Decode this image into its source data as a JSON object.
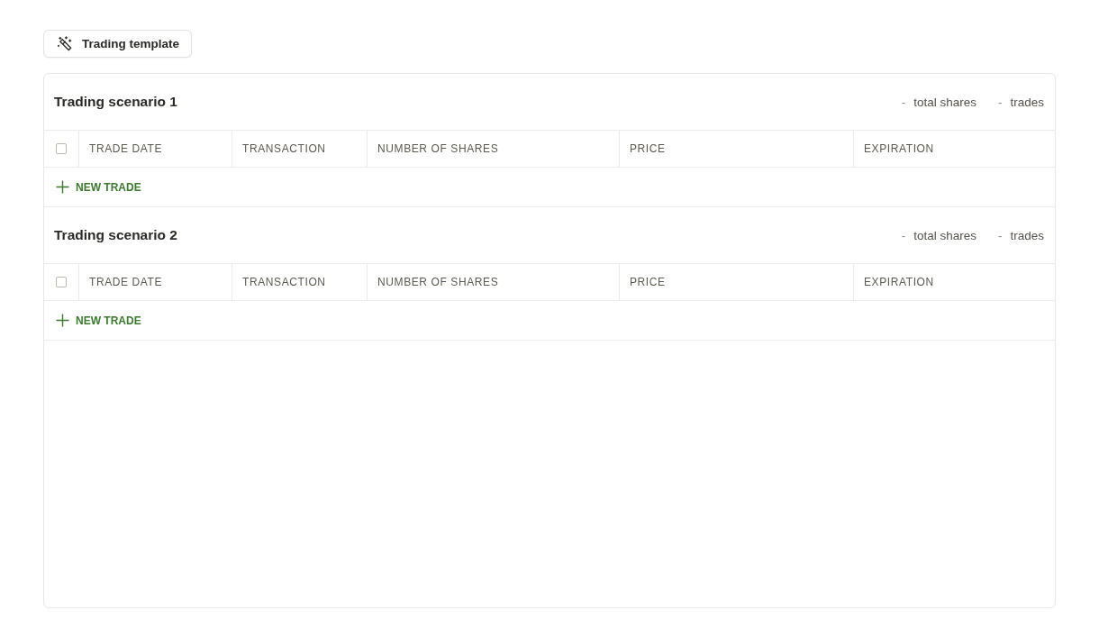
{
  "template_button": {
    "label": "Trading template"
  },
  "scenarios": [
    {
      "title": "Trading scenario 1",
      "stats": [
        {
          "value": "-",
          "label": "total shares"
        },
        {
          "value": "-",
          "label": "trades"
        }
      ],
      "table": {
        "select_all": {
          "checked": false
        },
        "columns": [
          "TRADE DATE",
          "TRANSACTION",
          "NUMBER OF SHARES",
          "PRICE",
          "EXPIRATION"
        ]
      },
      "add_button": {
        "label": "NEW TRADE"
      }
    },
    {
      "title": "Trading scenario 2",
      "stats": [
        {
          "value": "-",
          "label": "total shares"
        },
        {
          "value": "-",
          "label": "trades"
        }
      ],
      "table": {
        "select_all": {
          "checked": false
        },
        "columns": [
          "TRADE DATE",
          "TRANSACTION",
          "NUMBER OF SHARES",
          "PRICE",
          "EXPIRATION"
        ]
      },
      "add_button": {
        "label": "NEW TRADE"
      }
    }
  ]
}
